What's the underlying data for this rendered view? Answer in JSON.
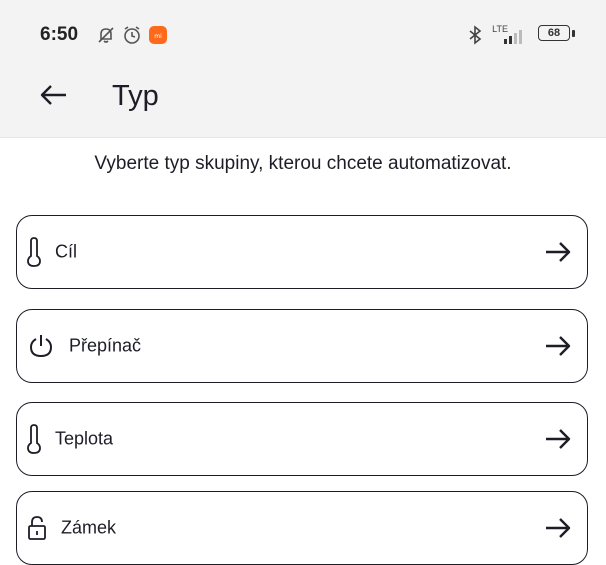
{
  "status_bar": {
    "time": "6:50",
    "network": "LTE",
    "battery": "68",
    "left_icons": [
      "notifications-off-icon",
      "alarm-icon",
      "app-notification-icon"
    ],
    "right_icons": [
      "bluetooth-icon",
      "signal-icon",
      "battery-icon"
    ]
  },
  "header": {
    "back_icon": "arrow-left-icon",
    "title": "Typ"
  },
  "main": {
    "instructions": "Vyberte typ skupiny, kterou chcete automatizovat.",
    "options": [
      {
        "label": "Cíl",
        "icon": "thermometer-icon"
      },
      {
        "label": "Přepínač",
        "icon": "power-icon"
      },
      {
        "label": "Teplota",
        "icon": "thermometer-icon"
      },
      {
        "label": "Zámek",
        "icon": "lock-icon"
      }
    ],
    "arrow_icon": "arrow-right-icon"
  },
  "colors": {
    "text": "#1d1d27",
    "bar_background": "#f3f3f3",
    "notification_badge": "#ff6a1a"
  }
}
